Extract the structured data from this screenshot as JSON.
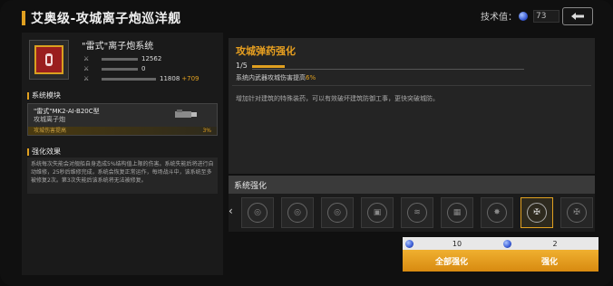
{
  "header": {
    "title": "艾奥级-攻城离子炮巡洋舰",
    "tech_label": "技术值：",
    "tech_value": "73"
  },
  "system": {
    "name": "\"雷式\"离子炮系统",
    "stats": [
      {
        "icon": "attack-icon",
        "value": "12562",
        "bonus": ""
      },
      {
        "icon": "defense-icon",
        "value": "0",
        "bonus": ""
      },
      {
        "icon": "health-icon",
        "value": "11808",
        "bonus": "+709"
      }
    ]
  },
  "module_section": {
    "title": "系统模块",
    "module_name": "\"雷式\"MK2-AI-B20C型",
    "module_type": "攻城离子炮",
    "effect_label": "攻城伤害提高",
    "effect_value": "3%"
  },
  "effect_section": {
    "title": "强化效果",
    "text": "系统每次失能会对舰船自身造成5%结构值上限的伤害。系统失能后将进行自动维修，25秒后维修完成，系统会恢复正常运作，每场战斗中，该系统至多被修复2次。第3次失能后该系统将无法被修复。"
  },
  "detail": {
    "title": "攻城弹药强化",
    "level": "1/5",
    "desc_prefix": "系统内武器攻城伤害提高",
    "desc_value": "6%",
    "flavor": "增加针对建筑的特殊装药，可以有效破坏建筑防御工事，更快突破城防。"
  },
  "enhance": {
    "header": "系统强化",
    "slots": [
      "◎",
      "◎",
      "◎",
      "▣",
      "≋",
      "▦",
      "✸",
      "✠",
      "✠"
    ],
    "selected_index": 7
  },
  "buttons": {
    "all_cost": "10",
    "all_label": "全部强化",
    "one_cost": "2",
    "one_label": "强化"
  },
  "colors": {
    "accent": "#e0a020",
    "module_red": "#9a1e1e"
  }
}
